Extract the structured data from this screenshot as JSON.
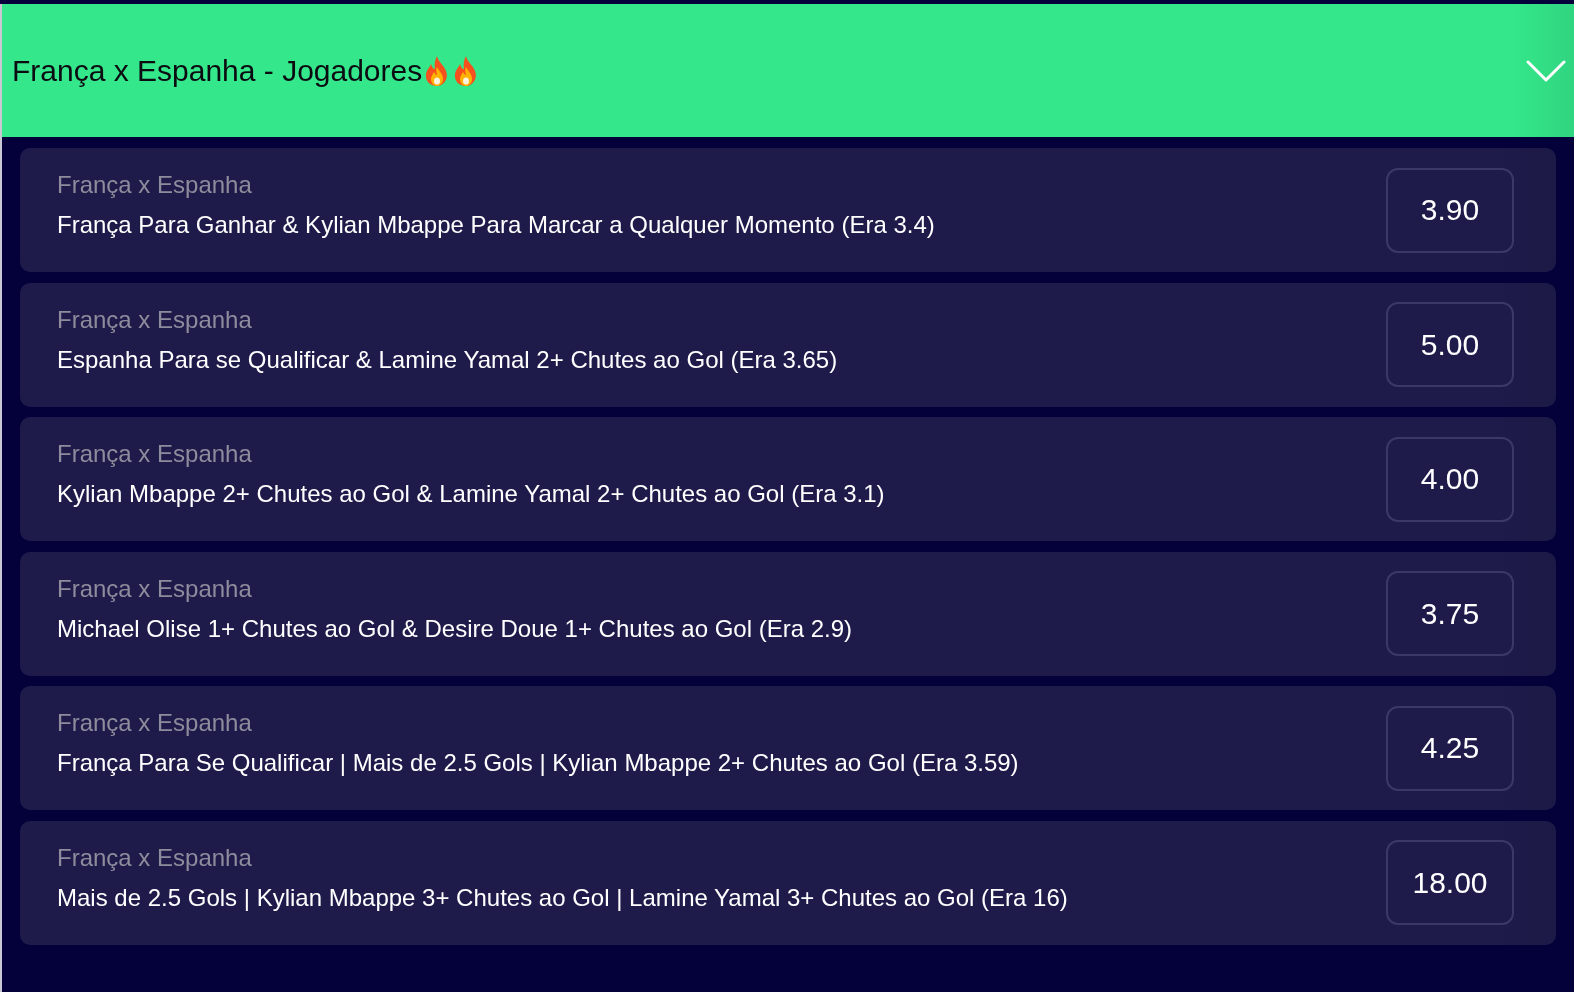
{
  "market": {
    "title": "França x Espanha - Jogadores"
  },
  "bets": [
    {
      "event": "França x Espanha",
      "selection": "França Para Ganhar & Kylian Mbappe Para Marcar a Qualquer Momento (Era 3.4)",
      "odds": "3.90"
    },
    {
      "event": "França x Espanha",
      "selection": "Espanha Para se Qualificar & Lamine Yamal 2+ Chutes ao Gol (Era 3.65)",
      "odds": "5.00"
    },
    {
      "event": "França x Espanha",
      "selection": "Kylian Mbappe 2+ Chutes ao Gol & Lamine Yamal 2+ Chutes ao Gol (Era 3.1)",
      "odds": "4.00"
    },
    {
      "event": "França x Espanha",
      "selection": "Michael Olise 1+ Chutes ao Gol & Desire Doue 1+ Chutes ao Gol (Era 2.9)",
      "odds": "3.75"
    },
    {
      "event": "França x Espanha",
      "selection": "França Para Se Qualificar | Mais de 2.5 Gols | Kylian Mbappe 2+ Chutes ao Gol (Era 3.59)",
      "odds": "4.25"
    },
    {
      "event": "França x Espanha",
      "selection": "Mais de 2.5 Gols | Kylian Mbappe 3+ Chutes ao Gol | Lamine Yamal 3+ Chutes ao Gol (Era 16)",
      "odds": "18.00"
    }
  ]
}
